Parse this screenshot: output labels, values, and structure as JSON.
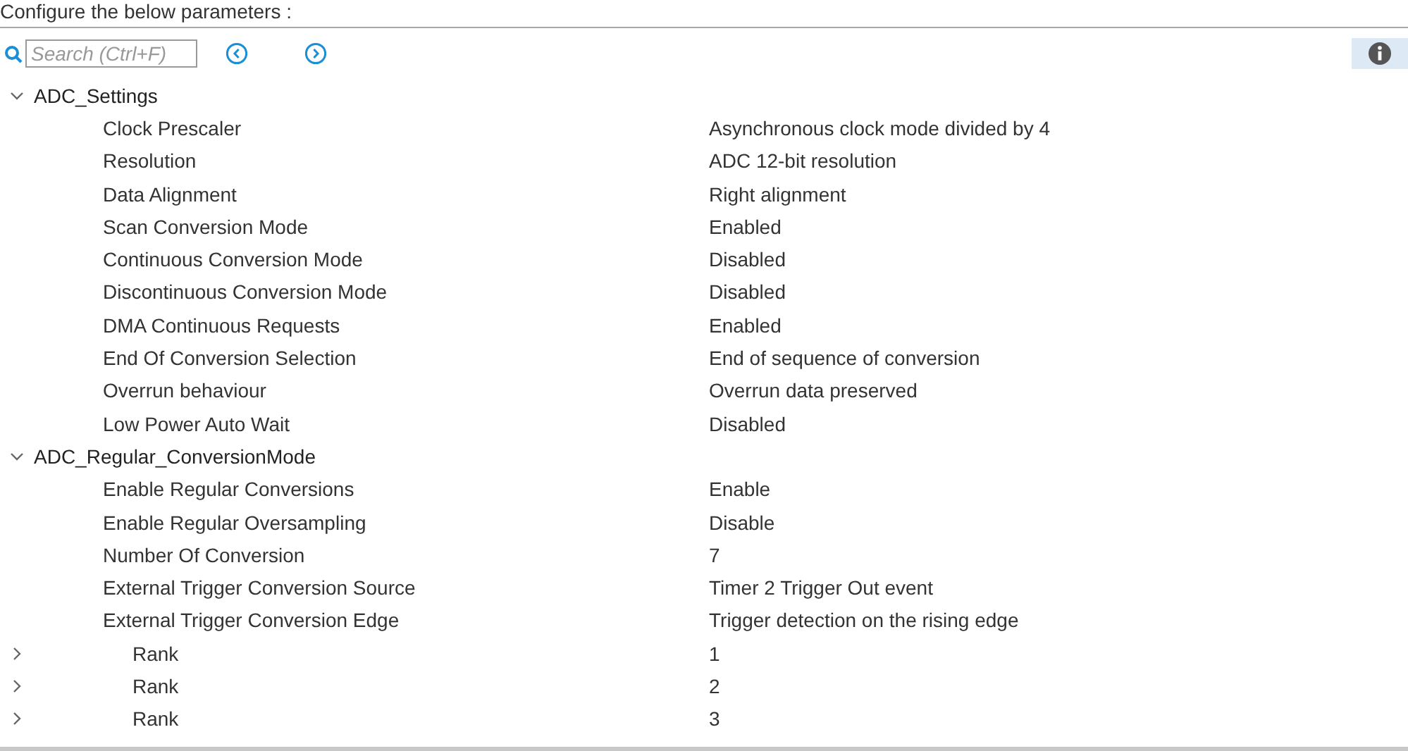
{
  "header": "Configure the below parameters :",
  "search": {
    "placeholder": "Search (Ctrl+F)"
  },
  "groups": [
    {
      "label": "ADC_Settings",
      "expanded": true,
      "children": [
        {
          "label": "Clock Prescaler",
          "value": "Asynchronous clock mode divided by 4"
        },
        {
          "label": "Resolution",
          "value": "ADC 12-bit resolution"
        },
        {
          "label": "Data Alignment",
          "value": "Right alignment"
        },
        {
          "label": "Scan Conversion Mode",
          "value": "Enabled"
        },
        {
          "label": "Continuous Conversion Mode",
          "value": "Disabled"
        },
        {
          "label": "Discontinuous Conversion Mode",
          "value": "Disabled"
        },
        {
          "label": "DMA Continuous Requests",
          "value": "Enabled"
        },
        {
          "label": "End Of Conversion Selection",
          "value": "End of sequence of conversion"
        },
        {
          "label": "Overrun behaviour",
          "value": "Overrun data preserved"
        },
        {
          "label": "Low Power Auto Wait",
          "value": "Disabled"
        }
      ]
    },
    {
      "label": "ADC_Regular_ConversionMode",
      "expanded": true,
      "children": [
        {
          "label": "Enable Regular Conversions",
          "value": "Enable"
        },
        {
          "label": "Enable Regular Oversampling",
          "value": "Disable"
        },
        {
          "label": "Number Of Conversion",
          "value": "7"
        },
        {
          "label": "External Trigger Conversion Source",
          "value": "Timer 2 Trigger Out event"
        },
        {
          "label": "External Trigger Conversion Edge",
          "value": "Trigger detection on the rising edge"
        },
        {
          "label": "Rank",
          "value": "1",
          "expanded": false
        },
        {
          "label": "Rank",
          "value": "2",
          "expanded": false
        },
        {
          "label": "Rank",
          "value": "3",
          "expanded": false
        }
      ]
    }
  ]
}
